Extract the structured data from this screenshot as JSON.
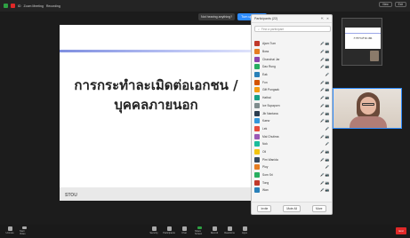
{
  "topbar": {
    "meeting_label": "ID",
    "meeting_name": "Zoom Meeting",
    "recording_label": "Recording",
    "view_label": "View",
    "exit_label": "Exit"
  },
  "audio_prompt": {
    "text": "Not hearing anything?",
    "button": "Turn up volume"
  },
  "slide": {
    "title_line1": "การกระทำละเมิดต่อเอกชน /",
    "title_line2": "บุคคลภายนอก",
    "logo": "STOU"
  },
  "participants": {
    "title": "Participants (22)",
    "search_placeholder": "Find a participant",
    "rows": [
      {
        "name": "Ajarn Tum",
        "color": "#c0392b",
        "icons": "🎤 📷"
      },
      {
        "name": "Boss",
        "color": "#e67e22",
        "icons": "🎤 📷"
      },
      {
        "name": "Chanchai Jar",
        "color": "#8e44ad",
        "icons": "🎤 📷"
      },
      {
        "name": "Dao Rung",
        "color": "#27ae60",
        "icons": "🎤 📷"
      },
      {
        "name": "Eak",
        "color": "#2980b9",
        "icons": "🎤"
      },
      {
        "name": "Fon",
        "color": "#d35400",
        "icons": "🎤 📷"
      },
      {
        "name": "Gift Pongsak",
        "color": "#f39c12",
        "icons": "🎤 📷"
      },
      {
        "name": "Hathai",
        "color": "#16a085",
        "icons": "🎤 📷"
      },
      {
        "name": "Ice Supaporn",
        "color": "#7f8c8d",
        "icons": "🎤 📷"
      },
      {
        "name": "Jib Nantana",
        "color": "#2c3e50",
        "icons": "🎤 📷"
      },
      {
        "name": "Kaew",
        "color": "#3498db",
        "icons": "🎤 📷"
      },
      {
        "name": "Lek",
        "color": "#e74c3c",
        "icons": "🎤"
      },
      {
        "name": "Mai Chutima",
        "color": "#9b59b6",
        "icons": "🎤 📷"
      },
      {
        "name": "Nok",
        "color": "#1abc9c",
        "icons": "🎤"
      },
      {
        "name": "Oil",
        "color": "#f1c40f",
        "icons": "🎤 📷"
      },
      {
        "name": "Pim Wanida",
        "color": "#34495e",
        "icons": "🎤 📷"
      },
      {
        "name": "Ploy",
        "color": "#e67e22",
        "icons": "🎤"
      },
      {
        "name": "Som Sri",
        "color": "#27ae60",
        "icons": "🎤 📷"
      },
      {
        "name": "Tong",
        "color": "#c0392b",
        "icons": "🎤 📷"
      },
      {
        "name": "Wan",
        "color": "#2980b9",
        "icons": "🎤 📷"
      }
    ],
    "invite": "Invite",
    "mute_all": "Mute All",
    "more": "More"
  },
  "thumb": {
    "slide_text": "การกระทำละเมิด"
  },
  "bottombar": {
    "mute": "Unmute",
    "video": "Start Video",
    "security": "Security",
    "participants": "Participants",
    "chat": "Chat",
    "share": "Share Screen",
    "record": "Record",
    "reactions": "Reactions",
    "apps": "Apps",
    "end": "End"
  },
  "colors": {
    "accent": "#2d8cff",
    "end": "#e02828"
  }
}
